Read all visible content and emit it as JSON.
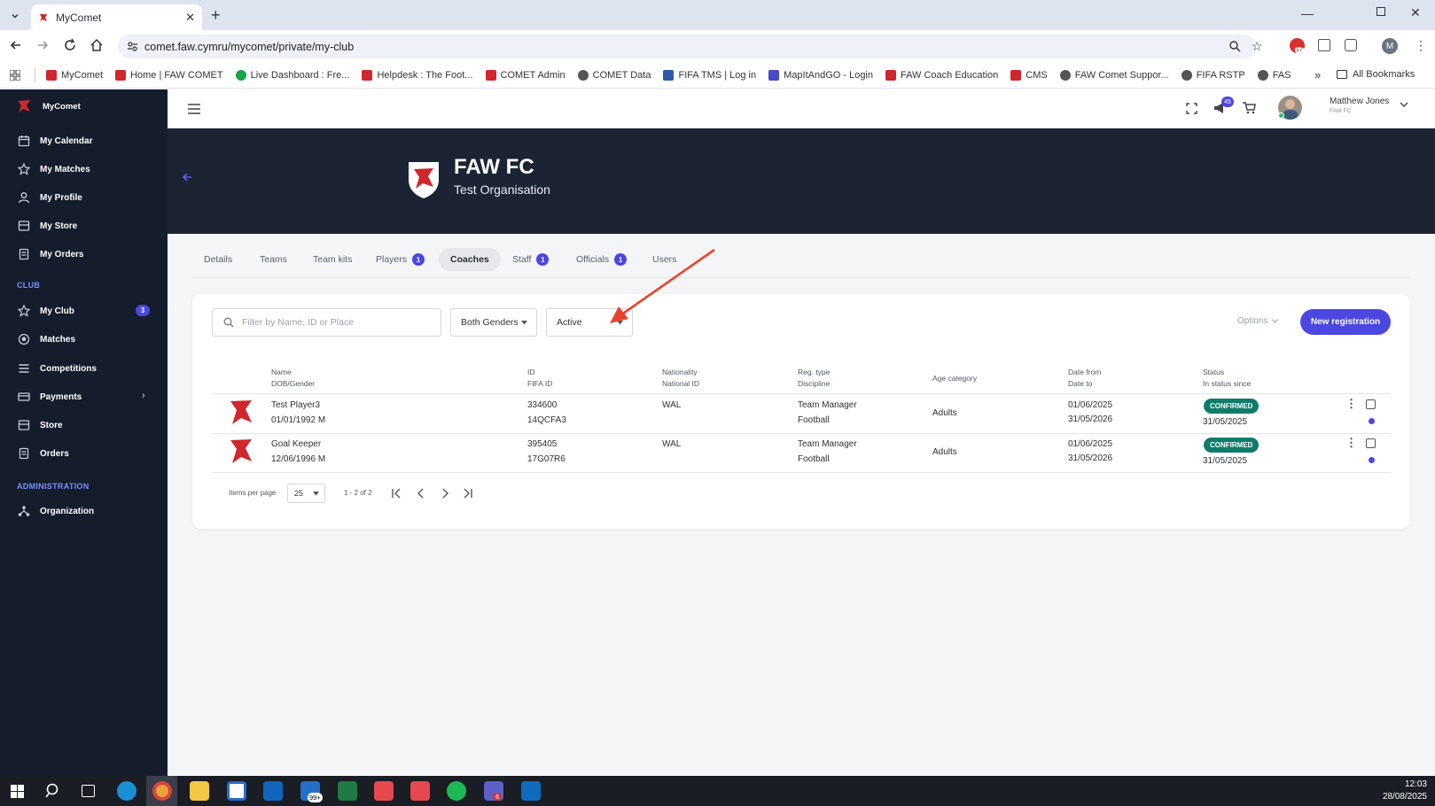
{
  "browser": {
    "tab_title": "MyComet",
    "url": "comet.faw.cymru/mycomet/private/my-club",
    "extension_badge": "17",
    "profile_initial": "M",
    "bookmarks": [
      "MyComet",
      "Home | FAW COMET",
      "Live Dashboard : Fre...",
      "Helpdesk : The Foot...",
      "COMET Admin",
      "COMET Data",
      "FIFA TMS | Log in",
      "MapItAndGO - Login",
      "FAW Coach Education",
      "CMS",
      "FAW Comet Suppor...",
      "FIFA RSTP",
      "FAS"
    ],
    "all_bookmarks": "All Bookmarks"
  },
  "sidebar": {
    "brand": "MyComet",
    "personal": [
      "My Calendar",
      "My Matches",
      "My Profile",
      "My Store",
      "My Orders"
    ],
    "club_heading": "CLUB",
    "club": [
      "My Club",
      "Matches",
      "Competitions",
      "Payments",
      "Store",
      "Orders"
    ],
    "my_club_badge": "3",
    "admin_heading": "ADMINISTRATION",
    "admin": [
      "Organization"
    ]
  },
  "appbar": {
    "notifications_count": "45",
    "user_name": "Matthew Jones",
    "user_org": "FAW FC"
  },
  "club": {
    "name": "FAW FC",
    "subtitle": "Test Organisation"
  },
  "tabs": [
    {
      "label": "Details",
      "badge": ""
    },
    {
      "label": "Teams",
      "badge": ""
    },
    {
      "label": "Team kits",
      "badge": ""
    },
    {
      "label": "Players",
      "badge": "1"
    },
    {
      "label": "Coaches",
      "badge": ""
    },
    {
      "label": "Staff",
      "badge": "1"
    },
    {
      "label": "Officials",
      "badge": "1"
    },
    {
      "label": "Users",
      "badge": ""
    }
  ],
  "filters": {
    "search_placeholder": "Filter by Name, ID or Place",
    "gender": "Both Genders",
    "status": "Active",
    "options": "Options",
    "new_registration": "New registration"
  },
  "table": {
    "headers": [
      [
        "Name",
        "DOB/Gender"
      ],
      [
        "ID",
        "FIFA ID"
      ],
      [
        "Nationality",
        "National ID"
      ],
      [
        "Reg. type",
        "Discipline"
      ],
      [
        "Age category",
        ""
      ],
      [
        "Date from",
        "Date to"
      ],
      [
        "Status",
        "In status since"
      ]
    ],
    "rows": [
      {
        "name": "Test Player3",
        "dob": "01/01/1992 M",
        "id": "334600",
        "fifa_id": "14QCFA3",
        "nationality": "WAL",
        "reg_type": "Team Manager",
        "discipline": "Football",
        "age_category": "Adults",
        "date_from": "01/06/2025",
        "date_to": "31/05/2026",
        "status": "CONFIRMED",
        "status_since": "31/05/2025"
      },
      {
        "name": "Goal Keeper",
        "dob": "12/06/1996 M",
        "id": "395405",
        "fifa_id": "17G07R6",
        "nationality": "WAL",
        "reg_type": "Team Manager",
        "discipline": "Football",
        "age_category": "Adults",
        "date_from": "01/06/2025",
        "date_to": "31/05/2026",
        "status": "CONFIRMED",
        "status_since": "31/05/2025"
      }
    ]
  },
  "pagination": {
    "items_per_page_label": "Items per page",
    "items_per_page": "25",
    "range": "1 - 2 of 2"
  },
  "taskbar": {
    "time": "12:03",
    "date": "28/08/2025",
    "mail_badge": "99+",
    "teams_badge": "6"
  },
  "colors": {
    "accent": "#4b47e0",
    "sidebar": "#151d2c",
    "banner": "#1c2434",
    "confirmed": "#0f7c69",
    "arrow": "#e8432e"
  }
}
